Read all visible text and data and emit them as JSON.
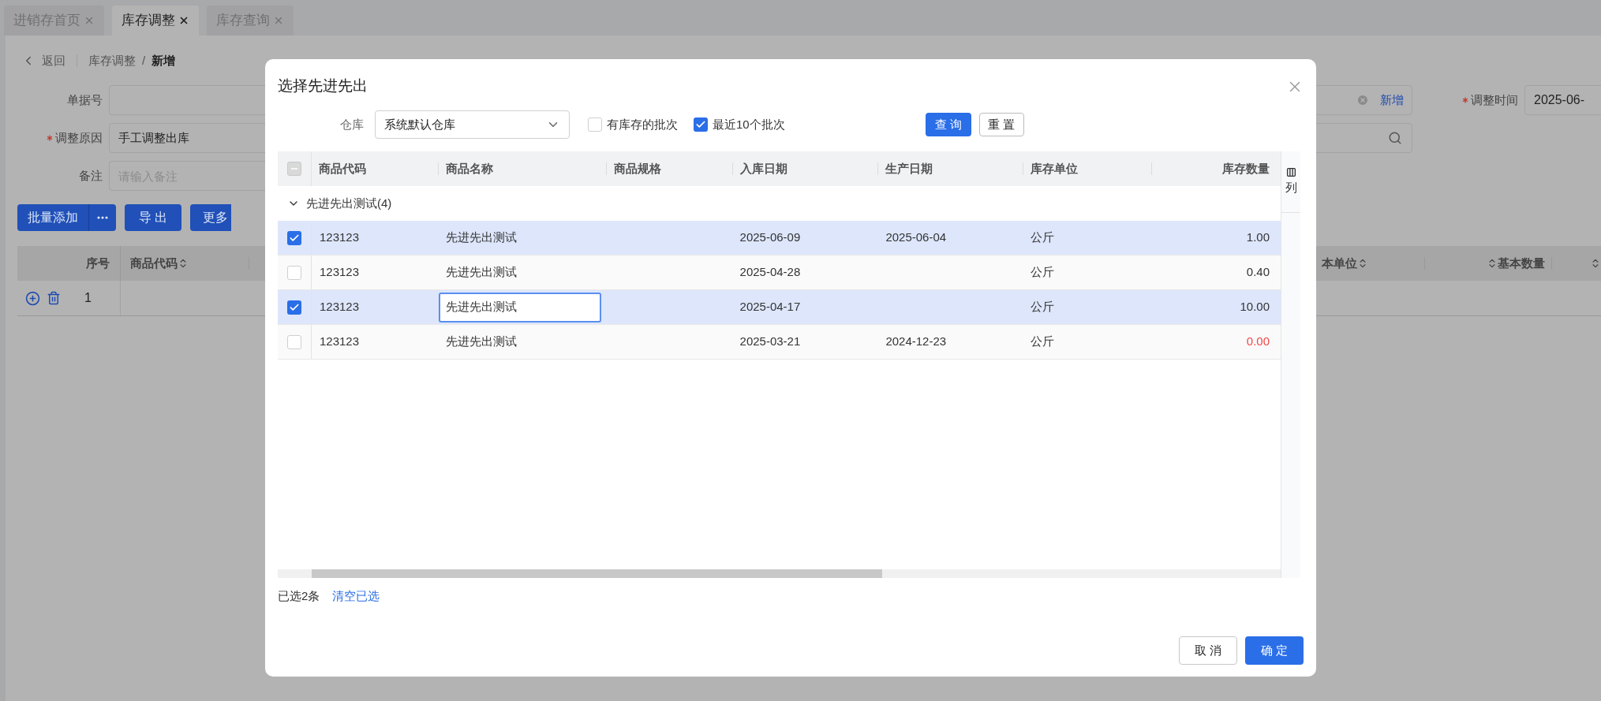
{
  "tabs": [
    {
      "label": "进销存首页",
      "selected": false
    },
    {
      "label": "库存调整",
      "selected": true
    },
    {
      "label": "库存查询",
      "selected": false
    }
  ],
  "breadcrumb": {
    "back": "返回",
    "path": [
      "库存调整",
      "新增"
    ],
    "separator": "/"
  },
  "form": {
    "doc_no": {
      "label": "单据号",
      "required": false
    },
    "reason": {
      "label": "调整原因",
      "required": true,
      "value": "手工调整出库"
    },
    "note": {
      "label": "备注",
      "required": false,
      "placeholder": "请输入备注"
    },
    "add_link": "新增",
    "time": {
      "label": "调整时间",
      "required": true,
      "value": "2025-06-"
    }
  },
  "toolbar": [
    "批量添加",
    "导 出",
    "更多"
  ],
  "main_table": {
    "columns": [
      "序号",
      "商品代码",
      "本单位",
      "基本数量"
    ],
    "rows": [
      {
        "index": "1"
      }
    ]
  },
  "dialog": {
    "title": "选择先进先出",
    "warehouse": {
      "label": "仓库",
      "value": "系统默认仓库"
    },
    "filters": [
      {
        "label": "有库存的批次",
        "checked": false
      },
      {
        "label": "最近10个批次",
        "checked": true
      }
    ],
    "query_button": "查 询",
    "reset_button": "重 置",
    "all_selected": false,
    "some_selected": true,
    "columns": [
      "商品代码",
      "商品名称",
      "商品规格",
      "入库日期",
      "生产日期",
      "库存单位",
      "库存数量"
    ],
    "column_setting": "列",
    "group": {
      "label": "先进先出测试(4)",
      "expanded": true
    },
    "rows": [
      {
        "selected": true,
        "code": "123123",
        "name": "先进先出测试",
        "in_date": "2025-06-09",
        "made_date": "2025-06-04",
        "unit": "公斤",
        "qty": "1.00",
        "name_focused": false,
        "qty_alert": false
      },
      {
        "selected": false,
        "code": "123123",
        "name": "先进先出测试",
        "in_date": "2025-04-28",
        "unit": "公斤",
        "qty": "0.40",
        "name_focused": false,
        "qty_alert": false
      },
      {
        "selected": true,
        "code": "123123",
        "name": "先进先出测试",
        "in_date": "2025-04-17",
        "unit": "公斤",
        "qty": "10.00",
        "name_focused": true,
        "qty_alert": false
      },
      {
        "selected": false,
        "code": "123123",
        "name": "先进先出测试",
        "in_date": "2025-03-21",
        "made_date": "2024-12-23",
        "unit": "公斤",
        "qty": "0.00",
        "name_focused": false,
        "qty_alert": true
      }
    ],
    "selected_count": "已选2条",
    "clear_link": "清空已选",
    "cancel_button": "取 消",
    "ok_button": "确 定"
  }
}
